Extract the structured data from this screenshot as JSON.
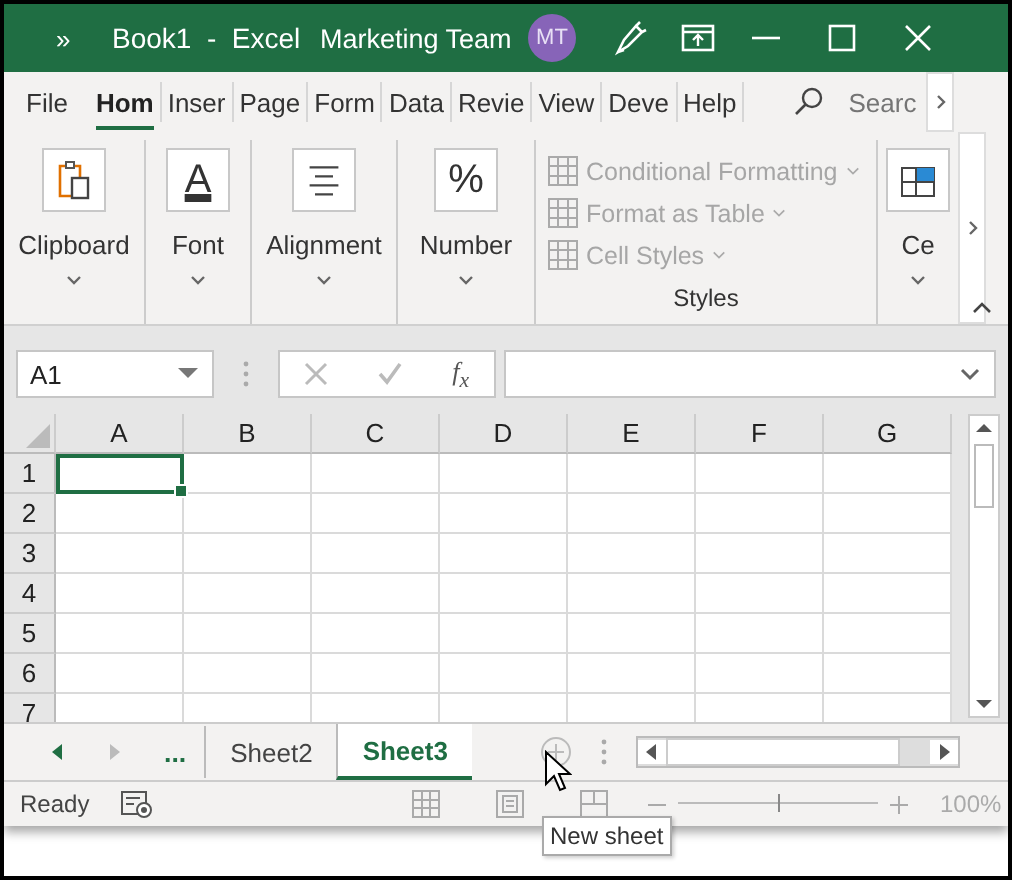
{
  "title_bar": {
    "overflow": "»",
    "document": "Book1  -  Excel",
    "account": "Marketing Team",
    "avatar": "MT"
  },
  "tabs": [
    {
      "label": "File",
      "selected": false
    },
    {
      "label": "Hom",
      "selected": true
    },
    {
      "label": "Inser",
      "selected": false
    },
    {
      "label": "Page",
      "selected": false
    },
    {
      "label": "Form",
      "selected": false
    },
    {
      "label": "Data",
      "selected": false
    },
    {
      "label": "Revie",
      "selected": false
    },
    {
      "label": "View",
      "selected": false
    },
    {
      "label": "Deve",
      "selected": false
    },
    {
      "label": "Help",
      "selected": false
    }
  ],
  "search": {
    "placeholder": "Searc"
  },
  "ribbon": {
    "groups": [
      {
        "kind": "clipboard",
        "label": "Clipboard"
      },
      {
        "kind": "glyph",
        "glyph": "A",
        "label": "Font"
      },
      {
        "kind": "alignment",
        "label": "Alignment"
      },
      {
        "kind": "glyph",
        "glyph": "%",
        "label": "Number"
      },
      {
        "kind": "list",
        "label": "Styles",
        "items": [
          {
            "label": "Conditional Formatting",
            "disabled": true
          },
          {
            "label": "Format as Table",
            "disabled": true
          },
          {
            "label": "Cell Styles",
            "disabled": true
          }
        ]
      },
      {
        "kind": "cells",
        "label": "Ce"
      }
    ]
  },
  "formula_bar": {
    "name_box": "A1",
    "fx": "f$_{x}$"
  },
  "grid": {
    "columns": [
      "A",
      "B",
      "C",
      "D",
      "E",
      "F",
      "G"
    ],
    "rows": [
      {
        "label": "1",
        "cells": [
          {
            "selected": true
          },
          {
            "selected": false
          },
          {
            "selected": false
          },
          {
            "selected": false
          },
          {
            "selected": false
          },
          {
            "selected": false
          },
          {
            "selected": false
          }
        ]
      },
      {
        "label": "2",
        "cells": [
          {
            "selected": false
          },
          {
            "selected": false
          },
          {
            "selected": false
          },
          {
            "selected": false
          },
          {
            "selected": false
          },
          {
            "selected": false
          },
          {
            "selected": false
          }
        ]
      },
      {
        "label": "3",
        "cells": [
          {
            "selected": false
          },
          {
            "selected": false
          },
          {
            "selected": false
          },
          {
            "selected": false
          },
          {
            "selected": false
          },
          {
            "selected": false
          },
          {
            "selected": false
          }
        ]
      },
      {
        "label": "4",
        "cells": [
          {
            "selected": false
          },
          {
            "selected": false
          },
          {
            "selected": false
          },
          {
            "selected": false
          },
          {
            "selected": false
          },
          {
            "selected": false
          },
          {
            "selected": false
          }
        ]
      },
      {
        "label": "5",
        "cells": [
          {
            "selected": false
          },
          {
            "selected": false
          },
          {
            "selected": false
          },
          {
            "selected": false
          },
          {
            "selected": false
          },
          {
            "selected": false
          },
          {
            "selected": false
          }
        ]
      },
      {
        "label": "6",
        "cells": [
          {
            "selected": false
          },
          {
            "selected": false
          },
          {
            "selected": false
          },
          {
            "selected": false
          },
          {
            "selected": false
          },
          {
            "selected": false
          },
          {
            "selected": false
          }
        ]
      },
      {
        "label": "7",
        "cells": [
          {
            "selected": false
          },
          {
            "selected": false
          },
          {
            "selected": false
          },
          {
            "selected": false
          },
          {
            "selected": false
          },
          {
            "selected": false
          },
          {
            "selected": false
          }
        ]
      }
    ]
  },
  "sheet_tabs": {
    "more": "...",
    "tabs": [
      {
        "label": "Sheet2",
        "selected": false
      },
      {
        "label": "Sheet3",
        "selected": true
      }
    ]
  },
  "status_bar": {
    "status": "Ready",
    "zoom": {
      "level": 0.5,
      "reading": "100%"
    }
  },
  "tooltip": {
    "text": "New sheet"
  }
}
